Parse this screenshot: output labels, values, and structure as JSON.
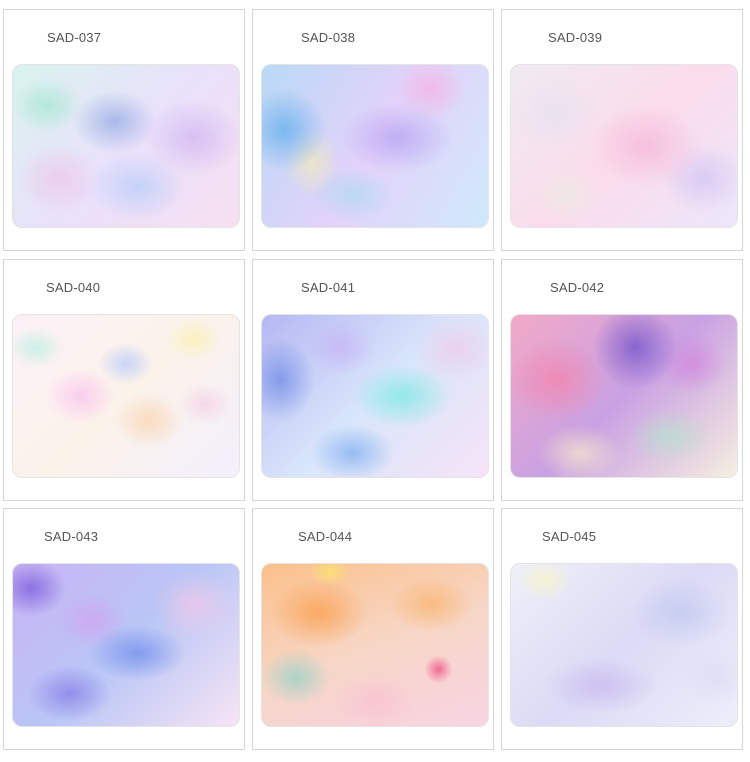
{
  "products": [
    {
      "code": "SAD-037"
    },
    {
      "code": "SAD-038"
    },
    {
      "code": "SAD-039"
    },
    {
      "code": "SAD-040"
    },
    {
      "code": "SAD-041"
    },
    {
      "code": "SAD-042"
    },
    {
      "code": "SAD-043"
    },
    {
      "code": "SAD-044"
    },
    {
      "code": "SAD-045"
    }
  ]
}
